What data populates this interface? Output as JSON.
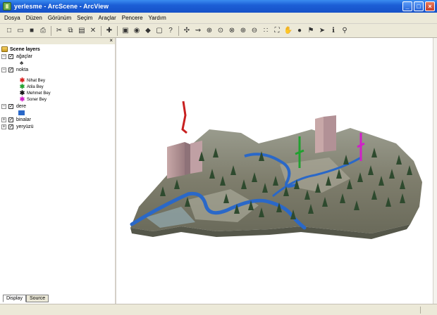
{
  "window": {
    "title": "yerlesme - ArcScene - ArcView",
    "buttons": {
      "minimize": "_",
      "maximize": "□",
      "close": "×"
    }
  },
  "menu": [
    "Dosya",
    "Düzen",
    "Görünüm",
    "Seçim",
    "Araçlar",
    "Pencere",
    "Yardım"
  ],
  "toolbar": {
    "icons": [
      {
        "name": "new-icon",
        "glyph": "□"
      },
      {
        "name": "open-icon",
        "glyph": "▭"
      },
      {
        "name": "save-icon",
        "glyph": "■"
      },
      {
        "name": "print-icon",
        "glyph": "⎙"
      },
      {
        "name": "cut-icon",
        "glyph": "✂"
      },
      {
        "name": "copy-icon",
        "glyph": "⧉"
      },
      {
        "name": "paste-icon",
        "glyph": "▤"
      },
      {
        "name": "delete-icon",
        "glyph": "✕"
      },
      {
        "name": "add-data-icon",
        "glyph": "✚"
      },
      {
        "name": "layer-properties-icon",
        "glyph": "▣"
      },
      {
        "name": "globe-icon",
        "glyph": "◉"
      },
      {
        "name": "toolbox-icon",
        "glyph": "◆"
      },
      {
        "name": "scene-viewer-icon",
        "glyph": "▢"
      },
      {
        "name": "whats-this-icon",
        "glyph": "?"
      },
      {
        "name": "navigate-icon",
        "glyph": "✣"
      },
      {
        "name": "fly-icon",
        "glyph": "⇝"
      },
      {
        "name": "zoom-target-icon",
        "glyph": "⊕"
      },
      {
        "name": "center-target-icon",
        "glyph": "⊙"
      },
      {
        "name": "narrow-target-icon",
        "glyph": "⊗"
      },
      {
        "name": "zoom-in-icon",
        "glyph": "⊕"
      },
      {
        "name": "zoom-out-icon",
        "glyph": "⊖"
      },
      {
        "name": "zoom-in-out-icon",
        "glyph": "∷"
      },
      {
        "name": "full-extent-icon",
        "glyph": "⛶"
      },
      {
        "name": "pan-icon",
        "glyph": "✋"
      },
      {
        "name": "globe-view-icon",
        "glyph": "●"
      },
      {
        "name": "measure-icon",
        "glyph": "⚑"
      },
      {
        "name": "select-icon",
        "glyph": "➤"
      },
      {
        "name": "identify-icon",
        "glyph": "ℹ"
      },
      {
        "name": "find-icon",
        "glyph": "⚲"
      }
    ],
    "separator_after": [
      3,
      7,
      8,
      13
    ]
  },
  "toc": {
    "close": "×",
    "root_label": "Scene layers",
    "layers": [
      {
        "id": "agaclar",
        "name": "ağaçlar",
        "expanded": true,
        "checked": true
      },
      {
        "id": "nokta",
        "name": "nokta",
        "expanded": true,
        "checked": true
      },
      {
        "id": "dere",
        "name": "dere",
        "expanded": true,
        "checked": true
      },
      {
        "id": "binalar",
        "name": "binalar",
        "expanded": false,
        "checked": true
      },
      {
        "id": "yeryuzu",
        "name": "yeryüzü",
        "expanded": false,
        "checked": true
      }
    ],
    "legend": [
      {
        "label": "Nihat Bey",
        "color": "#d82020"
      },
      {
        "label": "Atila Bey",
        "color": "#22a030"
      },
      {
        "label": "Mehmet Bey",
        "color": "#111111"
      },
      {
        "label": "Soner Bey",
        "color": "#d020c8"
      }
    ],
    "dere_color": "#2a68c8",
    "tabs": [
      "Display",
      "Source"
    ],
    "active_tab": "Display"
  },
  "glyphs": {
    "minus": "−",
    "plus": "+",
    "check": "✓",
    "person": "✱",
    "tree": "♣"
  }
}
